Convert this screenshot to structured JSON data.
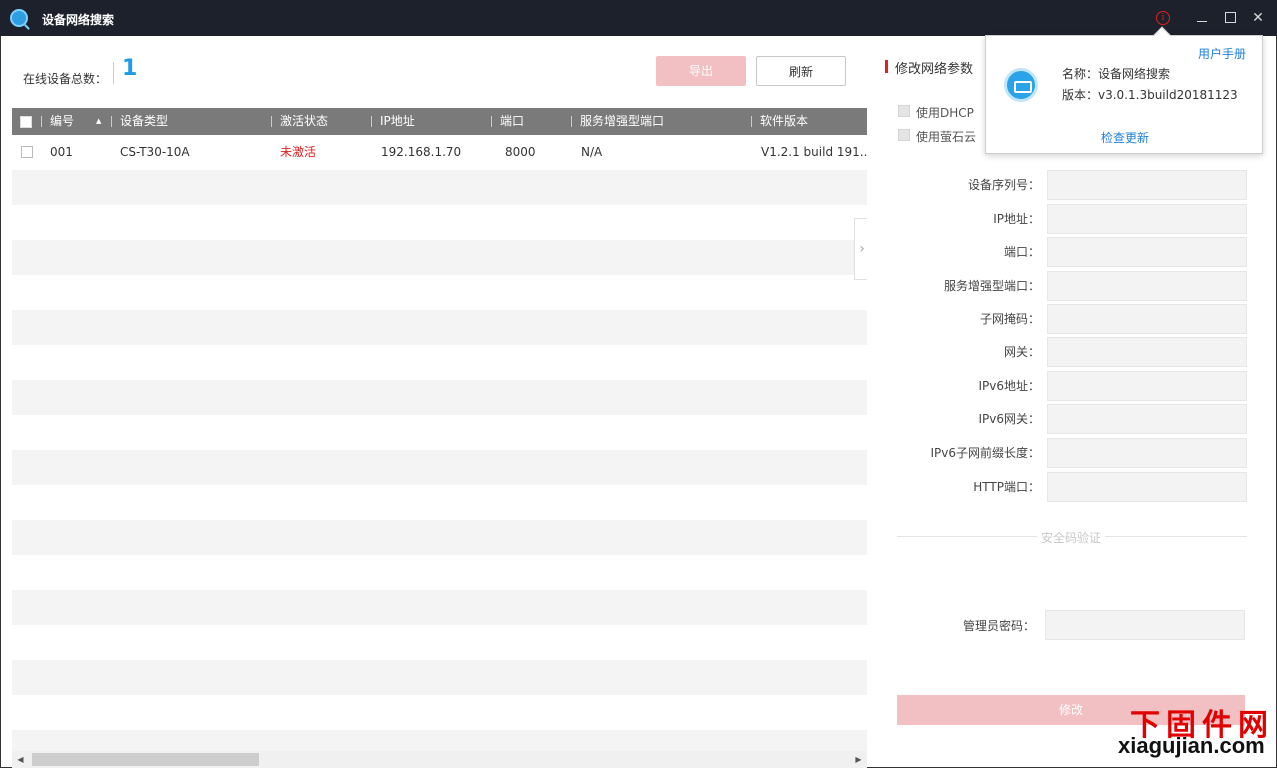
{
  "window": {
    "title": "设备网络搜索",
    "close_glyph": "✕",
    "info_glyph": "i"
  },
  "toolbar": {
    "online_label": "在线设备总数：",
    "online_count": "1",
    "export_label": "导出",
    "refresh_label": "刷新"
  },
  "table": {
    "columns": [
      "编号",
      "设备类型",
      "激活状态",
      "IP地址",
      "端口",
      "服务增强型端口",
      "软件版本"
    ],
    "rows": [
      {
        "id": "001",
        "type": "CS-T30-10A",
        "status": "未激活",
        "ip": "192.168.1.70",
        "port": "8000",
        "enhanced_port": "N/A",
        "version": "V1.2.1 build 191..."
      }
    ],
    "status_color": "#e02020",
    "scroll_left_glyph": "◀",
    "scroll_right_glyph": "▶"
  },
  "panel": {
    "collapse_glyph": "›",
    "title": "修改网络参数",
    "options": [
      "使用DHCP",
      "使用萤石云"
    ],
    "fields": [
      "设备序列号：",
      "IP地址：",
      "端口：",
      "服务增强型端口：",
      "子网掩码：",
      "网关：",
      "IPv6地址：",
      "IPv6网关：",
      "IPv6子网前缀长度：",
      "HTTP端口："
    ],
    "security_title": "安全码验证",
    "password_label": "管理员密码：",
    "modify_label": "修改"
  },
  "about_popup": {
    "manual_link": "用户手册",
    "name_text": "名称：设备网络搜索",
    "version_text": "版本：v3.0.1.3build20181123",
    "update_link": "检查更新"
  },
  "watermark": {
    "cn": "下固件网",
    "en": "xiagujian.com"
  },
  "colors": {
    "titlebar": "#1c212b",
    "accent_blue": "#1e9be6",
    "accent_red": "#e02020",
    "disabled_red": "#f2c0c3",
    "header_gray": "#7a7a7a"
  }
}
